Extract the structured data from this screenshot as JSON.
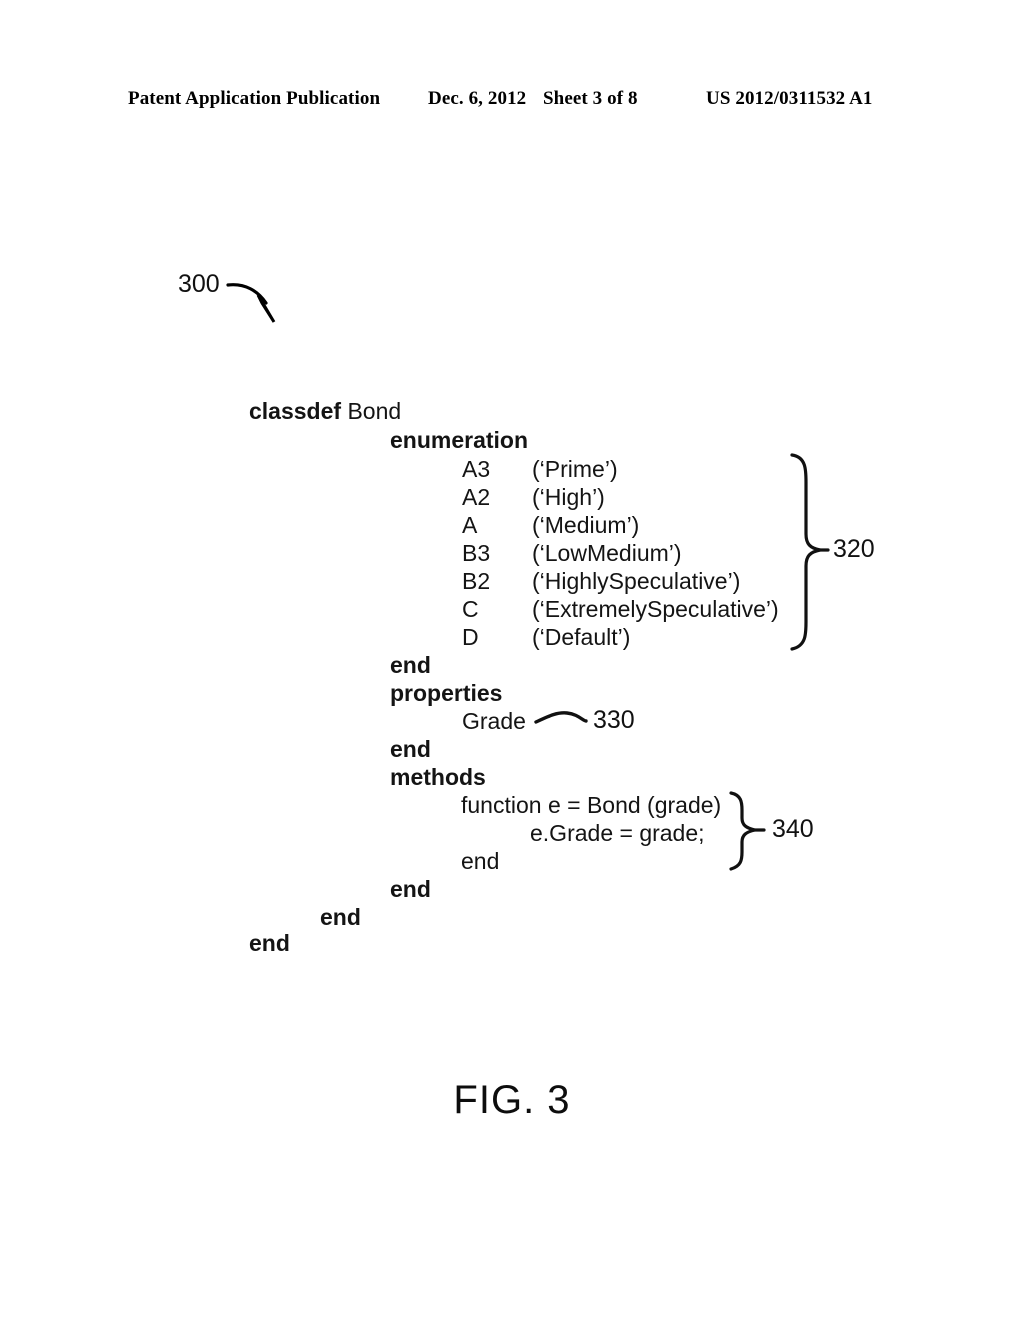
{
  "header": {
    "publication": "Patent Application Publication",
    "date": "Dec. 6, 2012",
    "sheet": "Sheet 3 of 8",
    "patent_number": "US 2012/0311532 A1"
  },
  "figure": {
    "caption": "FIG. 3",
    "diagram_label": "300"
  },
  "callouts": {
    "enumeration_block": "320",
    "properties_grade": "330",
    "methods_block": "340"
  },
  "code": {
    "classdef_keyword": "classdef",
    "class_name": "Bond",
    "enumeration_keyword": "enumeration",
    "enumeration_entries": [
      {
        "name": "A3",
        "value": "(‘Prime’)"
      },
      {
        "name": "A2",
        "value": "(‘High’)"
      },
      {
        "name": "A",
        "value": "(‘Medium’)"
      },
      {
        "name": "B3",
        "value": "(‘LowMedium’)"
      },
      {
        "name": "B2",
        "value": "(‘HighlySpeculative’)"
      },
      {
        "name": "C",
        "value": "(‘ExtremelySpeculative’)"
      },
      {
        "name": "D",
        "value": "(‘Default’)"
      }
    ],
    "end_after_enumeration": "end",
    "properties_keyword": "properties",
    "property_name": "Grade",
    "end_after_properties": "end",
    "methods_keyword": "methods",
    "method_signature": "function e = Bond (grade)",
    "method_body": "e.Grade = grade;",
    "method_end": "end",
    "end_after_methods": "end",
    "end_classdef_inner": "end",
    "end_classdef_outer": "end"
  }
}
